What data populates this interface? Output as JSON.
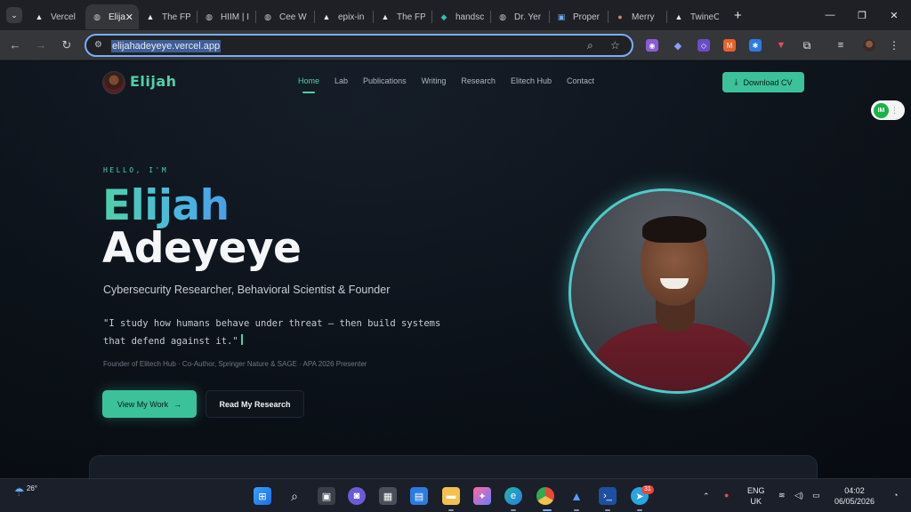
{
  "browser": {
    "tabs": [
      {
        "label": "Vercel",
        "icon": "vercel-icon",
        "active": false
      },
      {
        "label": "Elija",
        "icon": "globe-icon",
        "active": true
      },
      {
        "label": "The FP",
        "icon": "vercel-icon",
        "active": false
      },
      {
        "label": "HIIM | I",
        "icon": "globe-icon",
        "active": false
      },
      {
        "label": "Cee W",
        "icon": "globe-icon",
        "active": false
      },
      {
        "label": "epix-in",
        "icon": "vercel-icon",
        "active": false
      },
      {
        "label": "The FP",
        "icon": "vercel-icon",
        "active": false
      },
      {
        "label": "handsc",
        "icon": "diamond-icon",
        "active": false
      },
      {
        "label": "Dr. Yer",
        "icon": "globe-icon",
        "active": false
      },
      {
        "label": "Proper",
        "icon": "doc-icon",
        "active": false
      },
      {
        "label": "Merry",
        "icon": "avatar-icon",
        "active": false
      },
      {
        "label": "TwineC",
        "icon": "vercel-icon",
        "active": false
      }
    ],
    "url": "elijahadeyeye.vercel.app",
    "accent": "#7cacf8"
  },
  "site": {
    "logo_text": "Elijah",
    "nav": [
      "Home",
      "Lab",
      "Publications",
      "Writing",
      "Research",
      "Elitech Hub",
      "Contact"
    ],
    "active_nav": "Home",
    "download_label": "Download CV",
    "badge_label": "IM",
    "accent": "#4fd1a8"
  },
  "hero": {
    "greeting": "HELLO, I'M",
    "first_name": "Elijah",
    "last_name": "Adeyeye",
    "role": "Cybersecurity Researcher, Behavioral Scientist & Founder",
    "quote_line1": "\"I study how humans behave under threat — then build systems",
    "quote_line2": "that defend against it.\"",
    "credentials": "Founder of Elitech Hub · Co-Author, Springer Nature & SAGE · APA 2026 Presenter",
    "primary_button": "View My Work",
    "secondary_button": "Read My Research"
  },
  "taskbar": {
    "temperature": "26°",
    "language_line1": "ENG",
    "language_line2": "UK",
    "time": "04:02",
    "date": "06/05/2026",
    "telegram_badge": "31"
  }
}
